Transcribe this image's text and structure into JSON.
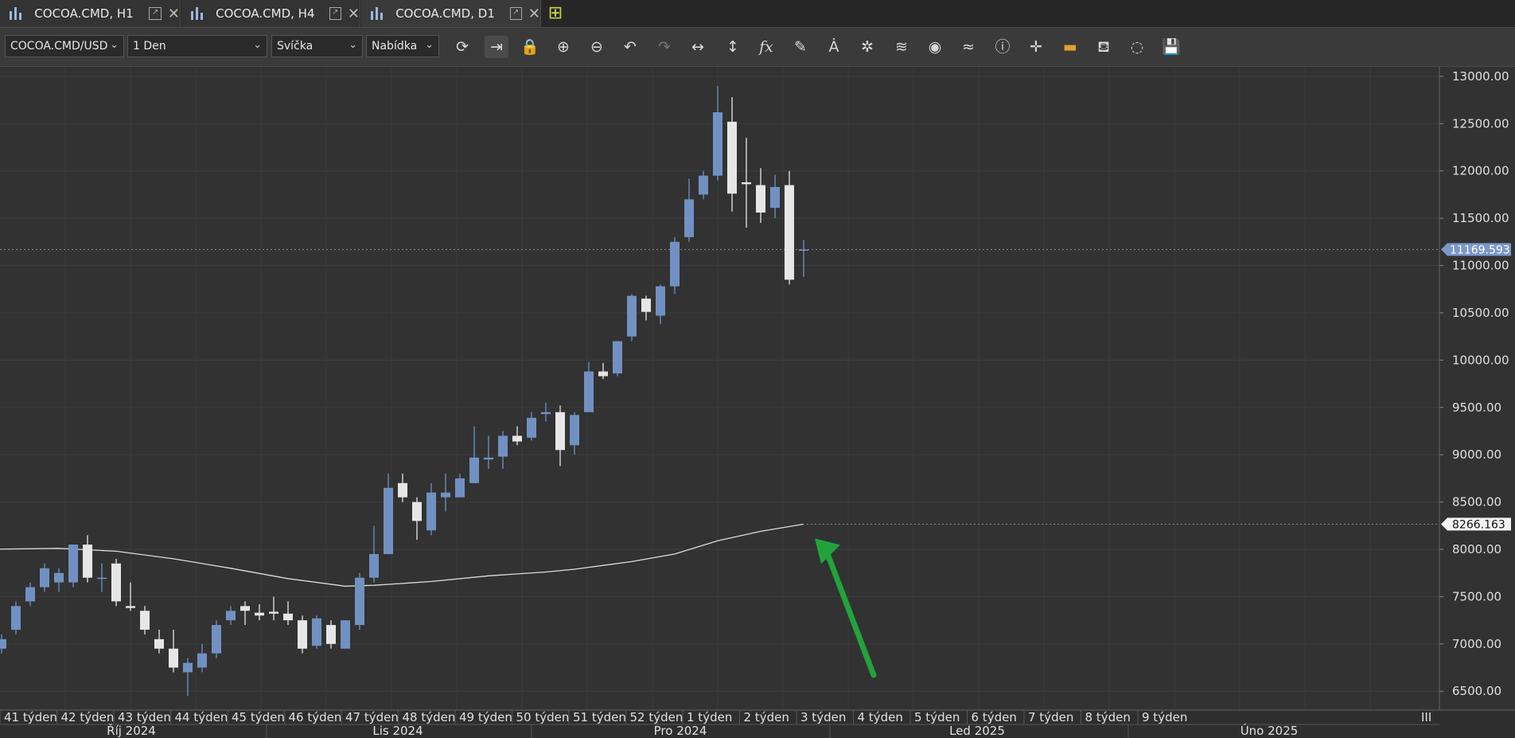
{
  "tabs": [
    {
      "label": "COCOA.CMD, H1"
    },
    {
      "label": "COCOA.CMD, H4"
    },
    {
      "label": "COCOA.CMD, D1"
    }
  ],
  "toolbar": {
    "symbol": "COCOA.CMD/USD",
    "timeframe": "1 Den",
    "chart_type": "Svíčka",
    "price_type": "Nabídka",
    "fx_label": "fx"
  },
  "colors": {
    "up": "#7191c3",
    "down": "#e6e6e6",
    "ma": "#dcdcdc",
    "background": "#323232",
    "arrow": "#22a33a"
  },
  "chart_data": {
    "type": "candlestick",
    "ylim": [
      6300,
      13100
    ],
    "yticks": [
      "6500.00",
      "7000.00",
      "7500.00",
      "8000.00",
      "8500.00",
      "9000.00",
      "9500.00",
      "10000.00",
      "10500.00",
      "11000.00",
      "11500.00",
      "12000.00",
      "12500.00",
      "13000.00"
    ],
    "current_price": "11169.593",
    "ma_value": "8266.163",
    "grid": true,
    "candles": [
      {
        "o": 6950,
        "h": 7100,
        "l": 6900,
        "c": 7050
      },
      {
        "o": 7150,
        "h": 7450,
        "l": 7100,
        "c": 7400
      },
      {
        "o": 7450,
        "h": 7650,
        "l": 7400,
        "c": 7600
      },
      {
        "o": 7600,
        "h": 7850,
        "l": 7550,
        "c": 7800
      },
      {
        "o": 7650,
        "h": 7800,
        "l": 7550,
        "c": 7750
      },
      {
        "o": 7650,
        "h": 8050,
        "l": 7600,
        "c": 8050
      },
      {
        "o": 8050,
        "h": 8150,
        "l": 7650,
        "c": 7700
      },
      {
        "o": 7700,
        "h": 7850,
        "l": 7550,
        "c": 7700
      },
      {
        "o": 7850,
        "h": 7900,
        "l": 7400,
        "c": 7450
      },
      {
        "o": 7400,
        "h": 7650,
        "l": 7350,
        "c": 7380
      },
      {
        "o": 7350,
        "h": 7400,
        "l": 7100,
        "c": 7150
      },
      {
        "o": 7050,
        "h": 7150,
        "l": 6900,
        "c": 6950
      },
      {
        "o": 6950,
        "h": 7150,
        "l": 6700,
        "c": 6750
      },
      {
        "o": 6700,
        "h": 6850,
        "l": 6450,
        "c": 6800
      },
      {
        "o": 6750,
        "h": 7000,
        "l": 6700,
        "c": 6900
      },
      {
        "o": 6900,
        "h": 7250,
        "l": 6850,
        "c": 7200
      },
      {
        "o": 7250,
        "h": 7400,
        "l": 7200,
        "c": 7350
      },
      {
        "o": 7400,
        "h": 7450,
        "l": 7200,
        "c": 7350
      },
      {
        "o": 7330,
        "h": 7420,
        "l": 7250,
        "c": 7300
      },
      {
        "o": 7340,
        "h": 7500,
        "l": 7250,
        "c": 7320
      },
      {
        "o": 7320,
        "h": 7450,
        "l": 7200,
        "c": 7250
      },
      {
        "o": 7250,
        "h": 7300,
        "l": 6900,
        "c": 6950
      },
      {
        "o": 6980,
        "h": 7300,
        "l": 6950,
        "c": 7270
      },
      {
        "o": 7200,
        "h": 7250,
        "l": 6950,
        "c": 7000
      },
      {
        "o": 6950,
        "h": 7250,
        "l": 6950,
        "c": 7250
      },
      {
        "o": 7200,
        "h": 7750,
        "l": 7150,
        "c": 7700
      },
      {
        "o": 7700,
        "h": 8250,
        "l": 7650,
        "c": 7950
      },
      {
        "o": 7950,
        "h": 8800,
        "l": 7950,
        "c": 8650
      },
      {
        "o": 8700,
        "h": 8800,
        "l": 8500,
        "c": 8550
      },
      {
        "o": 8500,
        "h": 8550,
        "l": 8100,
        "c": 8300
      },
      {
        "o": 8200,
        "h": 8700,
        "l": 8150,
        "c": 8600
      },
      {
        "o": 8550,
        "h": 8800,
        "l": 8400,
        "c": 8600
      },
      {
        "o": 8550,
        "h": 8800,
        "l": 8550,
        "c": 8750
      },
      {
        "o": 8700,
        "h": 9300,
        "l": 8700,
        "c": 8970
      },
      {
        "o": 8950,
        "h": 9200,
        "l": 8850,
        "c": 8970
      },
      {
        "o": 8980,
        "h": 9250,
        "l": 8850,
        "c": 9200
      },
      {
        "o": 9200,
        "h": 9300,
        "l": 9100,
        "c": 9140
      },
      {
        "o": 9180,
        "h": 9450,
        "l": 9150,
        "c": 9390
      },
      {
        "o": 9430,
        "h": 9550,
        "l": 9350,
        "c": 9450
      },
      {
        "o": 9450,
        "h": 9520,
        "l": 8880,
        "c": 9050
      },
      {
        "o": 9100,
        "h": 9450,
        "l": 9000,
        "c": 9420
      },
      {
        "o": 9450,
        "h": 9980,
        "l": 9450,
        "c": 9880
      },
      {
        "o": 9880,
        "h": 9970,
        "l": 9800,
        "c": 9830
      },
      {
        "o": 9860,
        "h": 10200,
        "l": 9830,
        "c": 10200
      },
      {
        "o": 10250,
        "h": 10700,
        "l": 10200,
        "c": 10680
      },
      {
        "o": 10650,
        "h": 10680,
        "l": 10420,
        "c": 10510
      },
      {
        "o": 10470,
        "h": 10800,
        "l": 10380,
        "c": 10780
      },
      {
        "o": 10780,
        "h": 11300,
        "l": 10700,
        "c": 11250
      },
      {
        "o": 11300,
        "h": 11920,
        "l": 11250,
        "c": 11700
      },
      {
        "o": 11750,
        "h": 12000,
        "l": 11700,
        "c": 11950
      },
      {
        "o": 11950,
        "h": 12900,
        "l": 11900,
        "c": 12620
      },
      {
        "o": 12520,
        "h": 12780,
        "l": 11570,
        "c": 11760
      },
      {
        "o": 11880,
        "h": 12350,
        "l": 11400,
        "c": 11860
      },
      {
        "o": 11850,
        "h": 12030,
        "l": 11450,
        "c": 11560
      },
      {
        "o": 11610,
        "h": 11960,
        "l": 11500,
        "c": 11830
      },
      {
        "o": 11850,
        "h": 12000,
        "l": 10800,
        "c": 10850
      },
      {
        "o": 11169,
        "h": 11270,
        "l": 10880,
        "c": 11169
      }
    ],
    "ma": [
      {
        "i": -1,
        "v": 8000
      },
      {
        "i": 4,
        "v": 8010
      },
      {
        "i": 8,
        "v": 7980
      },
      {
        "i": 12,
        "v": 7900
      },
      {
        "i": 16,
        "v": 7800
      },
      {
        "i": 20,
        "v": 7690
      },
      {
        "i": 24,
        "v": 7610
      },
      {
        "i": 26,
        "v": 7620
      },
      {
        "i": 30,
        "v": 7660
      },
      {
        "i": 34,
        "v": 7720
      },
      {
        "i": 38,
        "v": 7760
      },
      {
        "i": 40,
        "v": 7790
      },
      {
        "i": 44,
        "v": 7870
      },
      {
        "i": 47,
        "v": 7950
      },
      {
        "i": 50,
        "v": 8090
      },
      {
        "i": 53,
        "v": 8190
      },
      {
        "i": 56,
        "v": 8266
      }
    ],
    "xlabels_week": [
      "41 týden",
      "42 týden",
      "43 týden",
      "44 týden",
      "45 týden",
      "46 týden",
      "47 týden",
      "48 týden",
      "49 týden",
      "50 týden",
      "51 týden",
      "52 týden",
      "1 týden",
      "2 týden",
      "3 týden",
      "4 týden",
      "5 týden",
      "6 týden",
      "7 týden",
      "8 týden",
      "9 týden"
    ],
    "xlabels_month": [
      "Říj 2024",
      "Lis 2024",
      "Pro 2024",
      "Led 2025",
      "Úno 2025"
    ],
    "corner_label": "III"
  }
}
